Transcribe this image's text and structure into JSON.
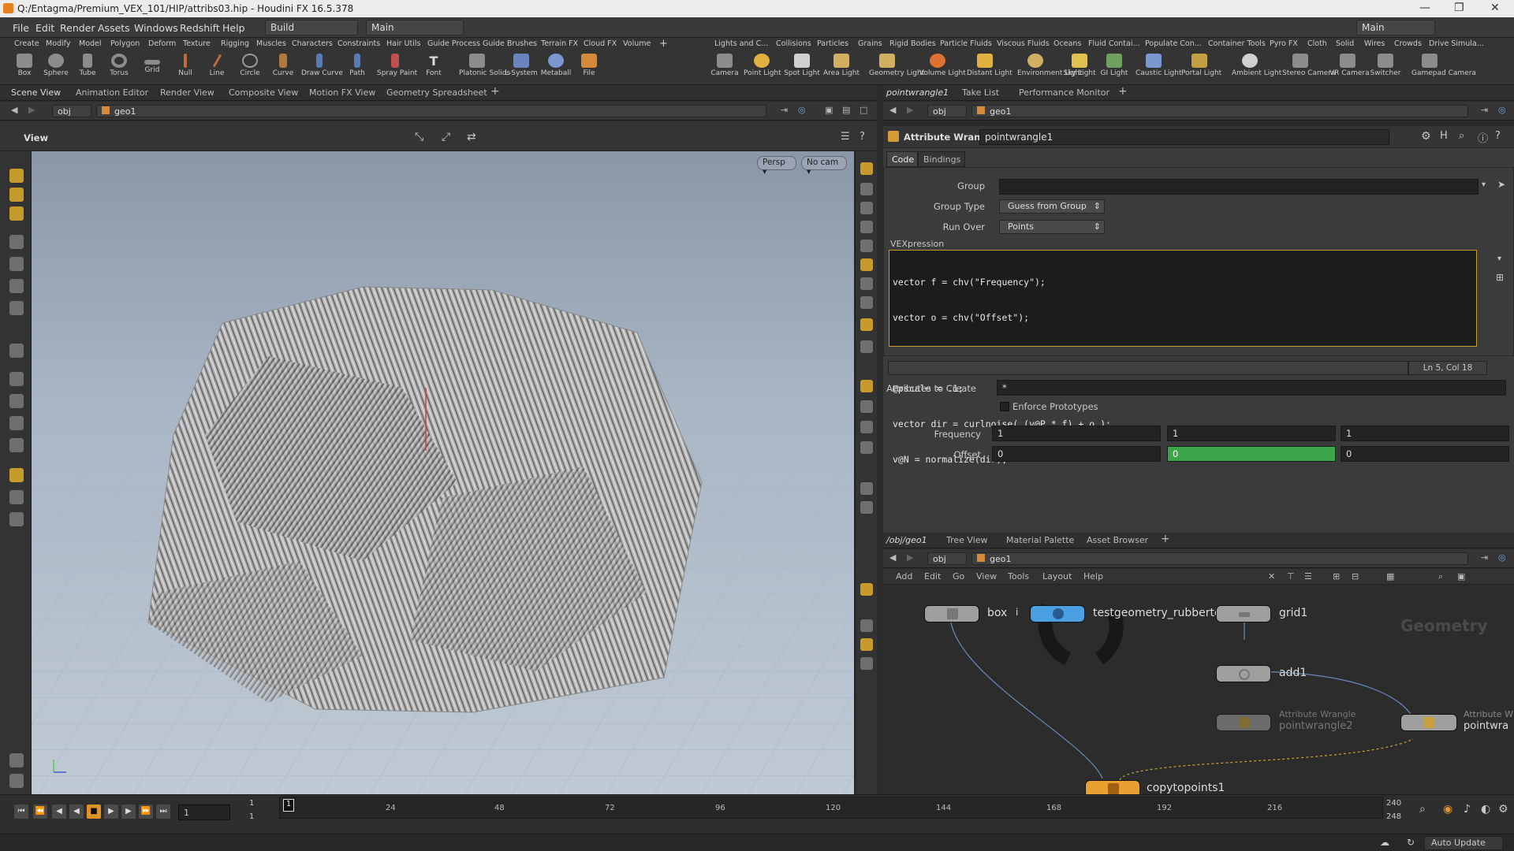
{
  "window": {
    "title": "Q:/Entagma/Premium_VEX_101/HIP/attribs03.hip - Houdini FX 16.5.378",
    "controls": [
      "—",
      "❐",
      "✕"
    ]
  },
  "menu": {
    "items": [
      "File",
      "Edit",
      "Render",
      "Assets",
      "Windows",
      "Redshift",
      "Help"
    ],
    "build": "Build",
    "desktop": "Main",
    "desktop_right": "Main"
  },
  "shelf": {
    "tabs_left": [
      "Create",
      "Modify",
      "Model",
      "Polygon",
      "Deform",
      "Texture",
      "Rigging",
      "Muscles",
      "Characters",
      "Constraints",
      "Hair Utils",
      "Guide Process",
      "Guide Brushes",
      "Terrain FX",
      "Cloud FX",
      "Volume"
    ],
    "tabs_right": [
      "Lights and C...",
      "Collisions",
      "Particles",
      "Grains",
      "Rigid Bodies",
      "Particle Fluids",
      "Viscous Fluids",
      "Oceans",
      "Fluid Contai...",
      "Populate Con...",
      "Container Tools",
      "Pyro FX",
      "Cloth",
      "Solid",
      "Wires",
      "Crowds",
      "Drive Simula..."
    ],
    "tools_left": [
      "Box",
      "Sphere",
      "Tube",
      "Torus",
      "Grid",
      "Null",
      "Line",
      "Circle",
      "Curve",
      "Draw Curve",
      "Path",
      "Spray Paint",
      "Font",
      "Platonic Solids",
      "L-System",
      "Metaball",
      "File"
    ],
    "tools_right": [
      "Camera",
      "Point Light",
      "Spot Light",
      "Area Light",
      "Geometry Light",
      "Volume Light",
      "Distant Light",
      "Environment Light",
      "Sky Light",
      "GI Light",
      "Caustic Light",
      "Portal Light",
      "Ambient Light",
      "Stereo Camera",
      "VR Camera",
      "Switcher",
      "Gamepad Camera"
    ]
  },
  "left_pane": {
    "tabs": [
      "Scene View",
      "Animation Editor",
      "Render View",
      "Composite View",
      "Motion FX View",
      "Geometry Spreadsheet"
    ],
    "path": [
      "obj",
      "geo1"
    ],
    "view_label": "View",
    "persp": "Persp",
    "cam": "No cam"
  },
  "right_pane": {
    "tabs": [
      "pointwrangle1",
      "Take List",
      "Performance Monitor"
    ],
    "path": [
      "obj",
      "geo1"
    ],
    "node_type": "Attribute Wrangle",
    "node_name": "pointwrangle1",
    "subtabs": [
      "Code",
      "Bindings"
    ],
    "group_label": "Group",
    "group_value": "",
    "group_type_label": "Group Type",
    "group_type_value": "Guess from Group",
    "run_over_label": "Run Over",
    "run_over_value": "Points",
    "vex_label": "VEXpression",
    "code_lines": [
      "vector f = chv(\"Frequency\");",
      "vector o = chv(\"Offset\");",
      "",
      "@pscale = .1;",
      "vector dir = curlnoise( (v@P * f) + o );",
      "v@N = normalize(dir);"
    ],
    "cursor_pos": "Ln 5, Col 18",
    "attribs_label": "Attributes to Create",
    "attribs_value": "*",
    "enforce_label": "Enforce Prototypes",
    "frequency_label": "Frequency",
    "frequency": [
      "1",
      "1",
      "1"
    ],
    "offset_label": "Offset",
    "offset": [
      "0",
      "0",
      "0"
    ]
  },
  "network": {
    "tabs": [
      "/obj/geo1",
      "Tree View",
      "Material Palette",
      "Asset Browser"
    ],
    "path": [
      "obj",
      "geo1"
    ],
    "menu": [
      "Add",
      "Edit",
      "Go",
      "View",
      "Tools",
      "Layout",
      "Help"
    ],
    "watermark": "Geometry",
    "nodes": [
      {
        "label": "box",
        "sub": ""
      },
      {
        "label": "testgeometry_rubbertoy",
        "sub": ""
      },
      {
        "label": "grid1",
        "sub": ""
      },
      {
        "label": "add1",
        "sub": ""
      },
      {
        "label": "Attribute Wrangle",
        "sub": "pointwrangle2"
      },
      {
        "label": "Attribute W",
        "sub": "pointwra"
      },
      {
        "label": "copytopoints1",
        "sub": ""
      }
    ]
  },
  "timeline": {
    "frame": "1",
    "start": "1",
    "start2": "1",
    "end": "240",
    "end2": "248",
    "ticks": [
      "1",
      "24",
      "48",
      "72",
      "96",
      "120",
      "144",
      "168",
      "192",
      "216"
    ],
    "current": "1"
  },
  "status": {
    "auto_update": "Auto Update"
  }
}
